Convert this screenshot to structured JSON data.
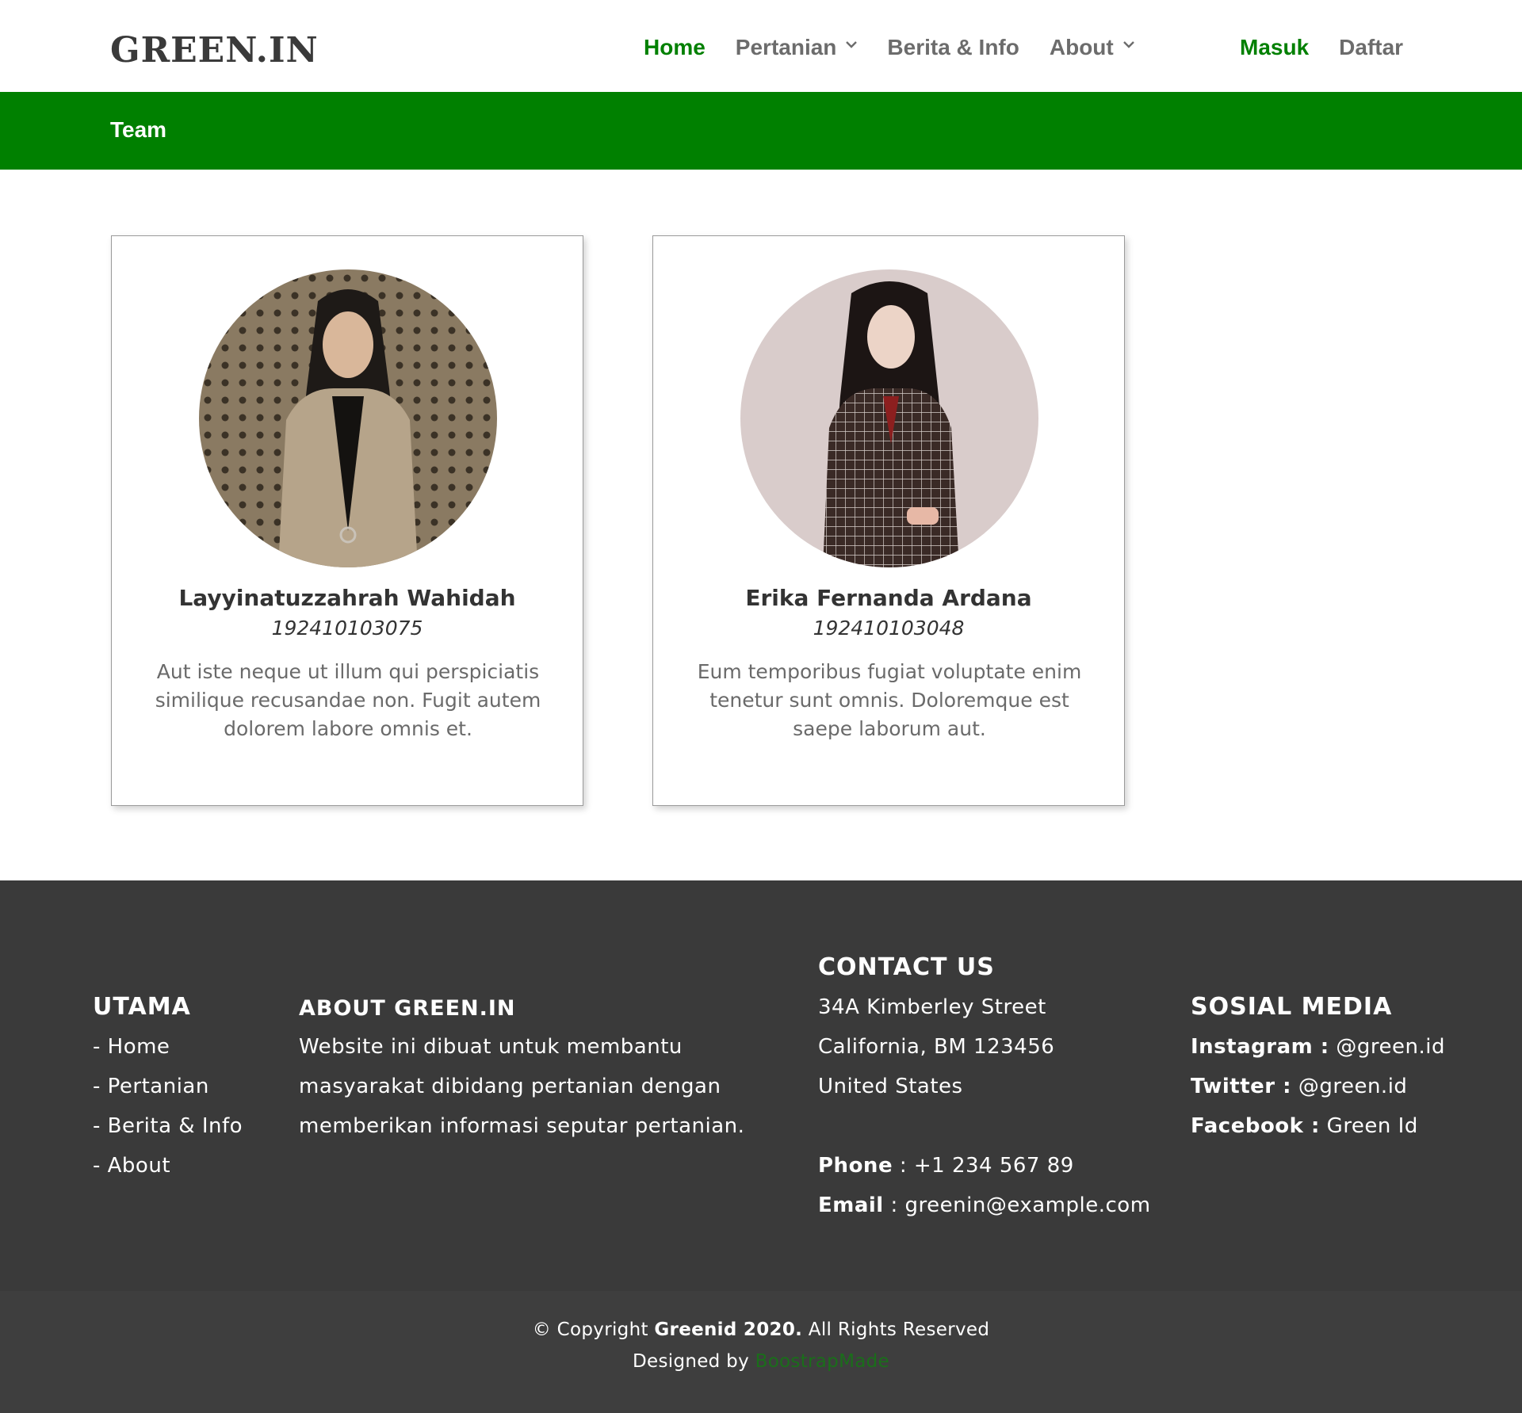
{
  "header": {
    "logo": "GREEN.IN",
    "nav": [
      {
        "label": "Home",
        "active": true,
        "dropdown": false
      },
      {
        "label": "Pertanian",
        "active": false,
        "dropdown": true
      },
      {
        "label": "Berita & Info",
        "active": false,
        "dropdown": false
      },
      {
        "label": "About",
        "active": false,
        "dropdown": true
      }
    ],
    "login": "Masuk",
    "register": "Daftar"
  },
  "banner": {
    "title": "Team"
  },
  "team": [
    {
      "name": "Layyinatuzzahrah Wahidah",
      "id": "192410103075",
      "description": "Aut iste neque ut illum qui perspiciatis similique recusandae non. Fugit autem dolorem labore omnis et."
    },
    {
      "name": "Erika Fernanda Ardana",
      "id": "192410103048",
      "description": "Eum temporibus fugiat voluptate enim tenetur sunt omnis. Doloremque est saepe laborum aut."
    }
  ],
  "footer": {
    "utama": {
      "heading": "UTAMA",
      "links": [
        "- Home",
        "- Pertanian",
        "- Berita & Info",
        "- About"
      ]
    },
    "about": {
      "heading": "ABOUT GREEN.IN",
      "lines": [
        "Website ini dibuat untuk membantu",
        "masyarakat dibidang pertanian dengan",
        "memberikan informasi seputar pertanian."
      ]
    },
    "contact": {
      "heading": "CONTACT US",
      "address": [
        "34A Kimberley Street",
        "California, BM 123456",
        "United States"
      ],
      "phone_label": "Phone",
      "phone": " : +1 234 567 89",
      "email_label": "Email",
      "email": " : greenin@example.com"
    },
    "social": {
      "heading": "SOSIAL MEDIA",
      "items": [
        {
          "label": "Instagram :",
          "value": " @green.id"
        },
        {
          "label": "Twitter :",
          "value": " @green.id"
        },
        {
          "label": "Facebook :",
          "value": " Green Id"
        }
      ]
    },
    "copyright": {
      "prefix": "© Copyright ",
      "brand": "Greenid 2020.",
      "suffix": " All Rights Reserved",
      "designed_by": "Designed by ",
      "designer": "BoostrapMade"
    }
  },
  "colors": {
    "brand_green": "#008000",
    "nav_text": "#6c6c6c",
    "footer_bg": "#3a3a3a",
    "copyright_bg": "#3e3e3e"
  }
}
